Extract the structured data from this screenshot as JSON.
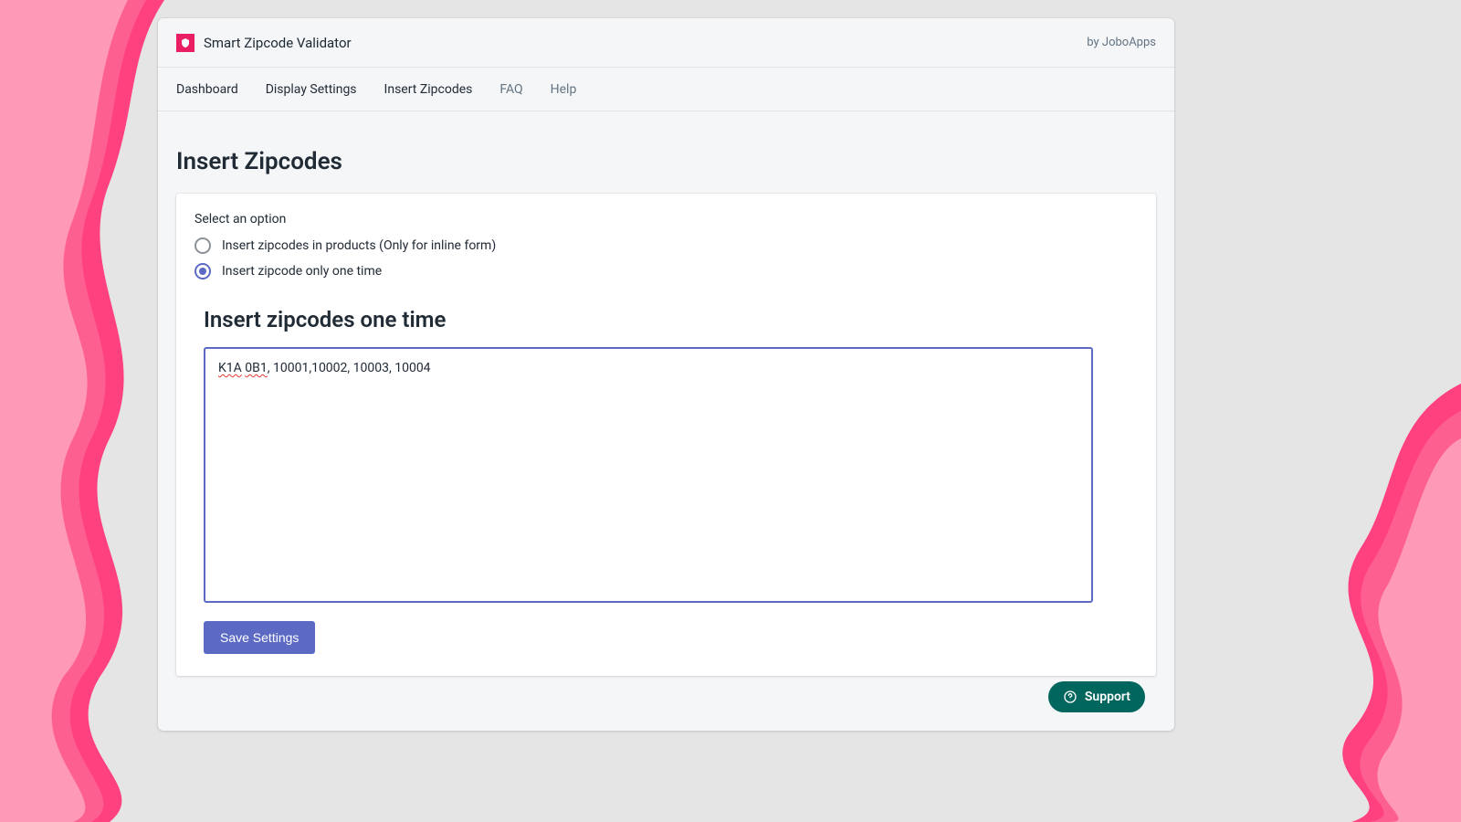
{
  "header": {
    "app_title": "Smart Zipcode Validator",
    "by_text": "by JoboApps"
  },
  "nav": {
    "items": [
      {
        "label": "Dashboard",
        "muted": false
      },
      {
        "label": "Display Settings",
        "muted": false
      },
      {
        "label": "Insert Zipcodes",
        "muted": false
      },
      {
        "label": "FAQ",
        "muted": true
      },
      {
        "label": "Help",
        "muted": true
      }
    ]
  },
  "page": {
    "title": "Insert Zipcodes",
    "option_group_label": "Select an option",
    "options": [
      {
        "label": "Insert zipcodes in products (Only for inline form)",
        "checked": false
      },
      {
        "label": "Insert zipcode only one time",
        "checked": true
      }
    ],
    "section_title": "Insert zipcodes one time",
    "textarea_value_parts": {
      "spell1": "K1A",
      "space": " ",
      "spell2": "0B1",
      "rest": ", 10001,10002, 10003, 10004"
    },
    "save_label": "Save Settings"
  },
  "support": {
    "label": "Support"
  }
}
